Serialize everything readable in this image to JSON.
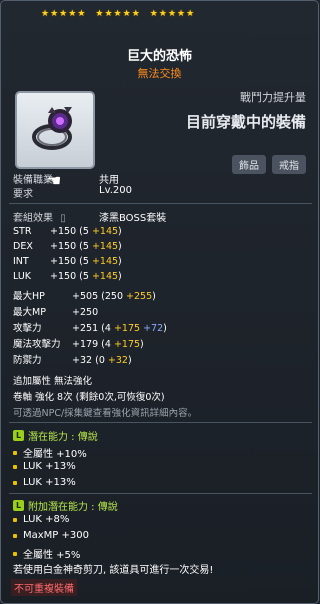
{
  "stars_per_group": [
    5,
    5,
    5
  ],
  "item": {
    "name": "巨大的恐怖",
    "trade_status": "無法交換",
    "power_label": "戰鬥力提升量",
    "equipped_text": "目前穿戴中的裝備",
    "tags": [
      "飾品",
      "戒指"
    ]
  },
  "requirements": {
    "job_label": "裝備職業",
    "job_value": "共用",
    "level_label": "要求",
    "level_value": "Lv.200"
  },
  "set": {
    "label": "套組效果",
    "value": "漆黑BOSS套裝"
  },
  "stats": [
    {
      "name": "STR",
      "base": "+150",
      "open": "(5",
      "bonus": "+145",
      "close": ")"
    },
    {
      "name": "DEX",
      "base": "+150",
      "open": "(5",
      "bonus": "+145",
      "close": ")"
    },
    {
      "name": "INT",
      "base": "+150",
      "open": "(5",
      "bonus": "+145",
      "close": ")"
    },
    {
      "name": "LUK",
      "base": "+150",
      "open": "(5",
      "bonus": "+145",
      "close": ")"
    },
    {
      "name": "最大HP",
      "base": "+505",
      "open": "(250",
      "bonus": "+255",
      "close": ")"
    },
    {
      "name": "最大MP",
      "base": "+250",
      "open": "",
      "bonus": "",
      "close": ""
    },
    {
      "name": "攻擊力",
      "base": "+251",
      "open": "(4",
      "bonus": "+175",
      "bonus2": "+72",
      "close": ")"
    },
    {
      "name": "魔法攻擊力",
      "base": "+179",
      "open": "(4",
      "bonus": "+175",
      "close": ")"
    },
    {
      "name": "防禦力",
      "base": "+32",
      "open": "(0",
      "bonus": "+32",
      "close": ")"
    }
  ],
  "extra": {
    "line1": "追加屬性 無法強化",
    "line2": "卷軸 強化 8次 (剩餘0次,可恢復0次)",
    "line3": "可透過NPC/採集鍵查看強化資訊詳細內容。"
  },
  "potential": {
    "label": "潛在能力 : 傳說",
    "lines": [
      "全屬性 +10%",
      "LUK +13%",
      "LUK +13%"
    ]
  },
  "additional_potential": {
    "label": "附加潛在能力 : 傳說",
    "lines": [
      "LUK +8%",
      "MaxMP +300",
      "全屬性 +5%"
    ]
  },
  "notice": "若使用白金神奇剪刀, 該道具可進行一次交易!",
  "no_repeat": "不可重複裝備"
}
